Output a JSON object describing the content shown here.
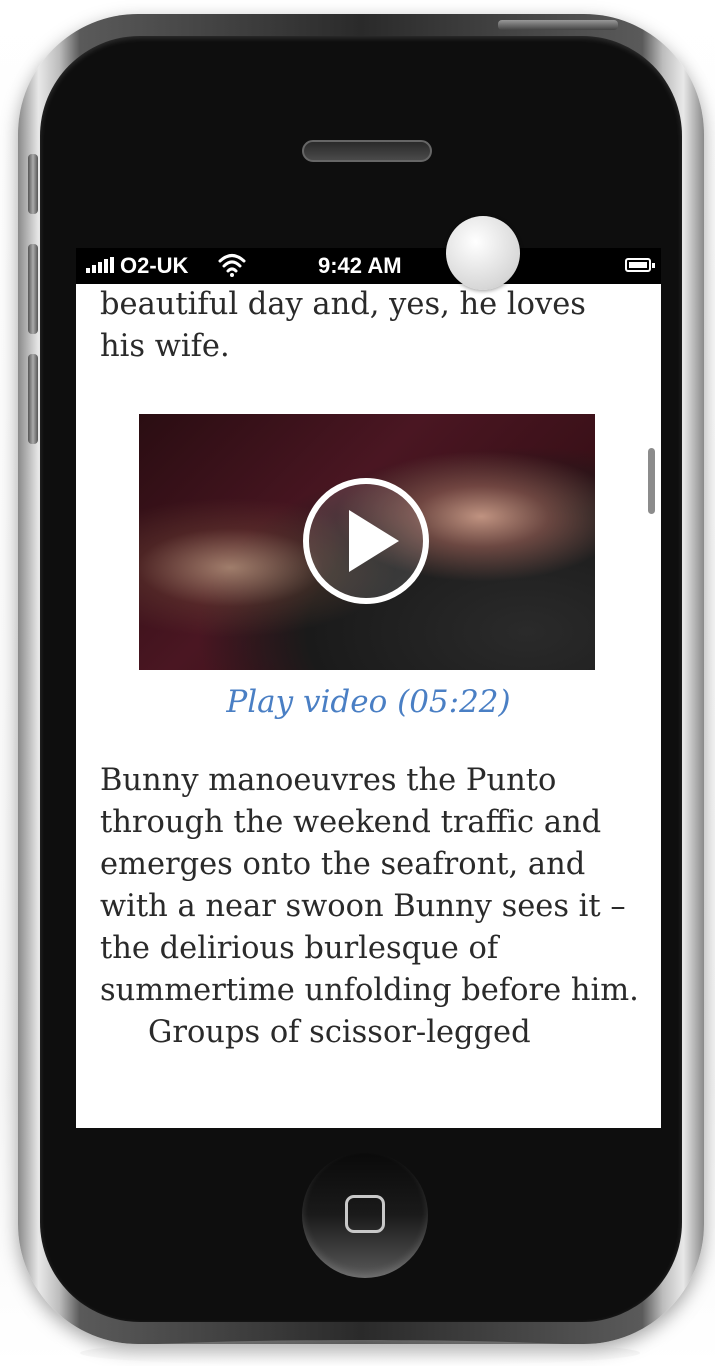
{
  "status_bar": {
    "carrier": "O2-UK",
    "time": "9:42 AM",
    "icons": [
      "signal-icon",
      "wifi-icon",
      "battery-icon"
    ]
  },
  "article": {
    "paragraph_top": "beautiful day and, yes, he loves his wife.",
    "video": {
      "link_label": "Play video (05:22)",
      "icon": "play-icon"
    },
    "paragraph_main": "Bunny manoeuvres the Punto through the weekend traffic and emerges onto the seafront, and with a near swoon Bunny sees it – the delirious burlesque of summertime unfolding before him.",
    "paragraph_next": "Groups of scissor-legged"
  },
  "colors": {
    "link": "#4a7fc4",
    "text": "#2a2a2a",
    "status_bar_bg": "#000000"
  }
}
